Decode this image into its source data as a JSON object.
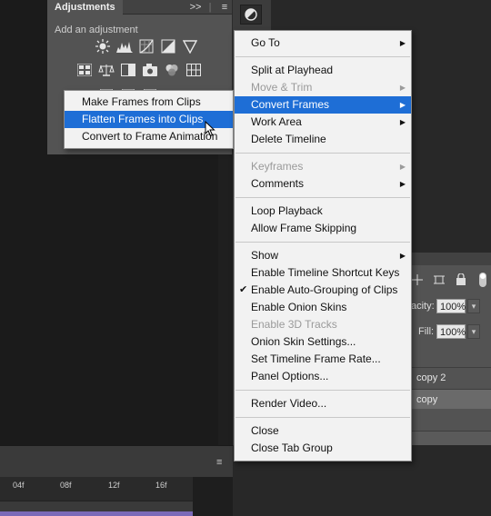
{
  "adjustments": {
    "tab_label": "Adjustments",
    "subtitle": "Add an adjustment",
    "collapse_glyph": ">>",
    "menu_glyph": "≡"
  },
  "layers": {
    "opacity_label": "acity:",
    "opacity_value": "100%",
    "fill_label": "Fill:",
    "fill_value": "100%",
    "rows": [
      "copy 2",
      "copy"
    ]
  },
  "timeline": {
    "ticks": [
      "04f",
      "08f",
      "12f",
      "16f"
    ],
    "menu_glyph": "≡",
    "bar_color": "#7b6ab8"
  },
  "submenu": {
    "items": [
      {
        "label": "Make Frames from Clips"
      },
      {
        "label": "Flatten Frames into Clips"
      },
      {
        "label": "Convert to Frame Animation"
      }
    ]
  },
  "menu": {
    "go_to": "Go To",
    "split_at_playhead": "Split at Playhead",
    "move_trim": "Move & Trim",
    "convert_frames": "Convert Frames",
    "work_area": "Work Area",
    "delete_timeline": "Delete Timeline",
    "keyframes": "Keyframes",
    "comments": "Comments",
    "loop_playback": "Loop Playback",
    "allow_frame_skipping": "Allow Frame Skipping",
    "show": "Show",
    "enable_shortcut_keys": "Enable Timeline Shortcut Keys",
    "enable_auto_grouping": "Enable Auto-Grouping of Clips",
    "enable_onion_skins": "Enable Onion Skins",
    "enable_3d_tracks": "Enable 3D Tracks",
    "onion_skin_settings": "Onion Skin Settings...",
    "set_frame_rate": "Set Timeline Frame Rate...",
    "panel_options": "Panel Options...",
    "render_video": "Render Video...",
    "close": "Close",
    "close_tab_group": "Close Tab Group"
  },
  "colors": {
    "highlight": "#1e6ed6",
    "menu_bg": "#f2f2f2",
    "panel_bg": "#535353"
  }
}
